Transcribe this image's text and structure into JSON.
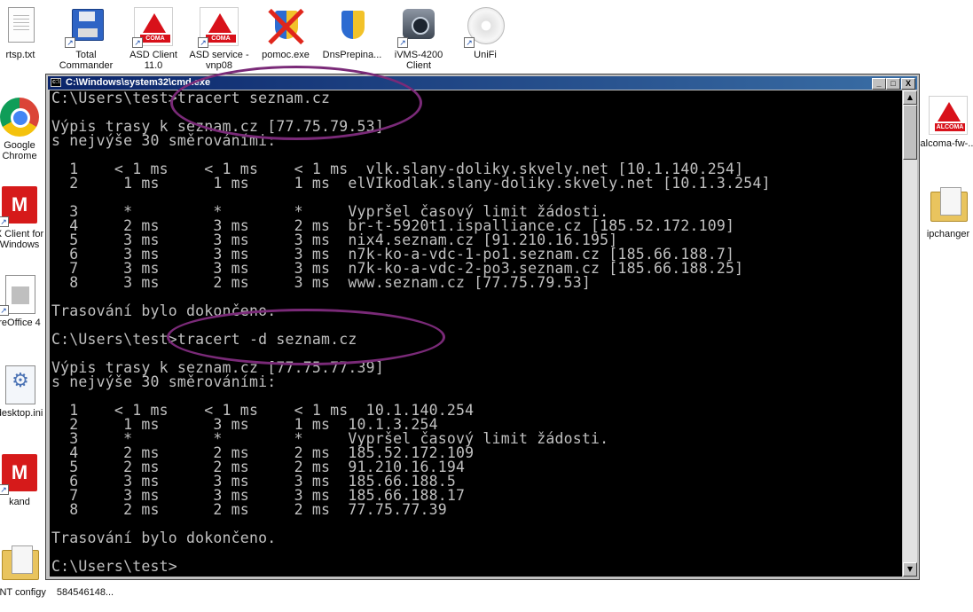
{
  "desktop": {
    "icons": [
      {
        "label": "rtsp.txt",
        "icon": "text-file-icon"
      },
      {
        "label": "Total Commander",
        "icon": "floppy-disk-icon"
      },
      {
        "label": "ASD Client 11.0",
        "icon": "coma-logo-icon",
        "logo_text": "COMA"
      },
      {
        "label": "ASD service - vnp08",
        "icon": "coma-logo-icon",
        "logo_text": "COMA"
      },
      {
        "label": "pomoc.exe",
        "icon": "shield-crossed-icon"
      },
      {
        "label": "DnsPrepina...",
        "icon": "shield-icon"
      },
      {
        "label": "iVMS-4200 Client",
        "icon": "camera-icon"
      },
      {
        "label": "UniFi",
        "icon": "disc-icon"
      },
      {
        "label": "Google Chrome",
        "icon": "chrome-icon"
      },
      {
        "label": "X Client for Windows",
        "icon": "x-client-icon"
      },
      {
        "label": "reOffice 4",
        "icon": "libreoffice-icon"
      },
      {
        "label": "desktop.ini",
        "icon": "settings-file-icon"
      },
      {
        "label": "kand",
        "icon": "x-client-icon"
      },
      {
        "label": "BNT configy",
        "icon": "folder-icon"
      },
      {
        "label": "584546148...",
        "icon": "file-icon"
      },
      {
        "label": "alcoma-fw-...",
        "icon": "alcoma-logo-icon",
        "logo_text": "ALCOMA"
      },
      {
        "label": "ipchanger",
        "icon": "folder-icon"
      }
    ]
  },
  "window": {
    "title": "C:\\Windows\\system32\\cmd.exe",
    "buttons": {
      "minimize": "_",
      "maximize": "□",
      "close": "X"
    }
  },
  "console": {
    "lines": [
      "C:\\Users\\test>tracert seznam.cz",
      "",
      "Výpis trasy k seznam.cz [77.75.79.53]",
      "s nejvýše 30 směrováními:",
      "",
      "  1    < 1 ms    < 1 ms    < 1 ms  vlk.slany-doliky.skvely.net [10.1.140.254]",
      "  2     1 ms      1 ms     1 ms  elVIkodlak.slany-doliky.skvely.net [10.1.3.254]",
      "",
      "  3     *         *        *     Vypršel časový limit žádosti.",
      "  4     2 ms      3 ms     2 ms  br-t-5920t1.ispalliance.cz [185.52.172.109]",
      "  5     3 ms      3 ms     3 ms  nix4.seznam.cz [91.210.16.195]",
      "  6     3 ms      3 ms     3 ms  n7k-ko-a-vdc-1-po1.seznam.cz [185.66.188.7]",
      "  7     3 ms      3 ms     3 ms  n7k-ko-a-vdc-2-po3.seznam.cz [185.66.188.25]",
      "  8     3 ms      2 ms     3 ms  www.seznam.cz [77.75.79.53]",
      "",
      "Trasování bylo dokončeno.",
      "",
      "C:\\Users\\test>tracert -d seznam.cz",
      "",
      "Výpis trasy k seznam.cz [77.75.77.39]",
      "s nejvýše 30 směrováními:",
      "",
      "  1    < 1 ms    < 1 ms    < 1 ms  10.1.140.254",
      "  2     1 ms      3 ms     1 ms  10.1.3.254",
      "  3     *         *        *     Vypršel časový limit žádosti.",
      "  4     2 ms      2 ms     2 ms  185.52.172.109",
      "  5     2 ms      2 ms     2 ms  91.210.16.194",
      "  6     3 ms      3 ms     3 ms  185.66.188.5",
      "  7     3 ms      3 ms     3 ms  185.66.188.17",
      "  8     2 ms      2 ms     2 ms  77.75.77.39",
      "",
      "Trasování bylo dokončeno.",
      "",
      "C:\\Users\\test>"
    ]
  },
  "colors": {
    "highlight_ring": "#7a2a78",
    "console_bg": "#000000",
    "console_fg": "#c0c0c0",
    "titlebar": "#0a246a"
  }
}
